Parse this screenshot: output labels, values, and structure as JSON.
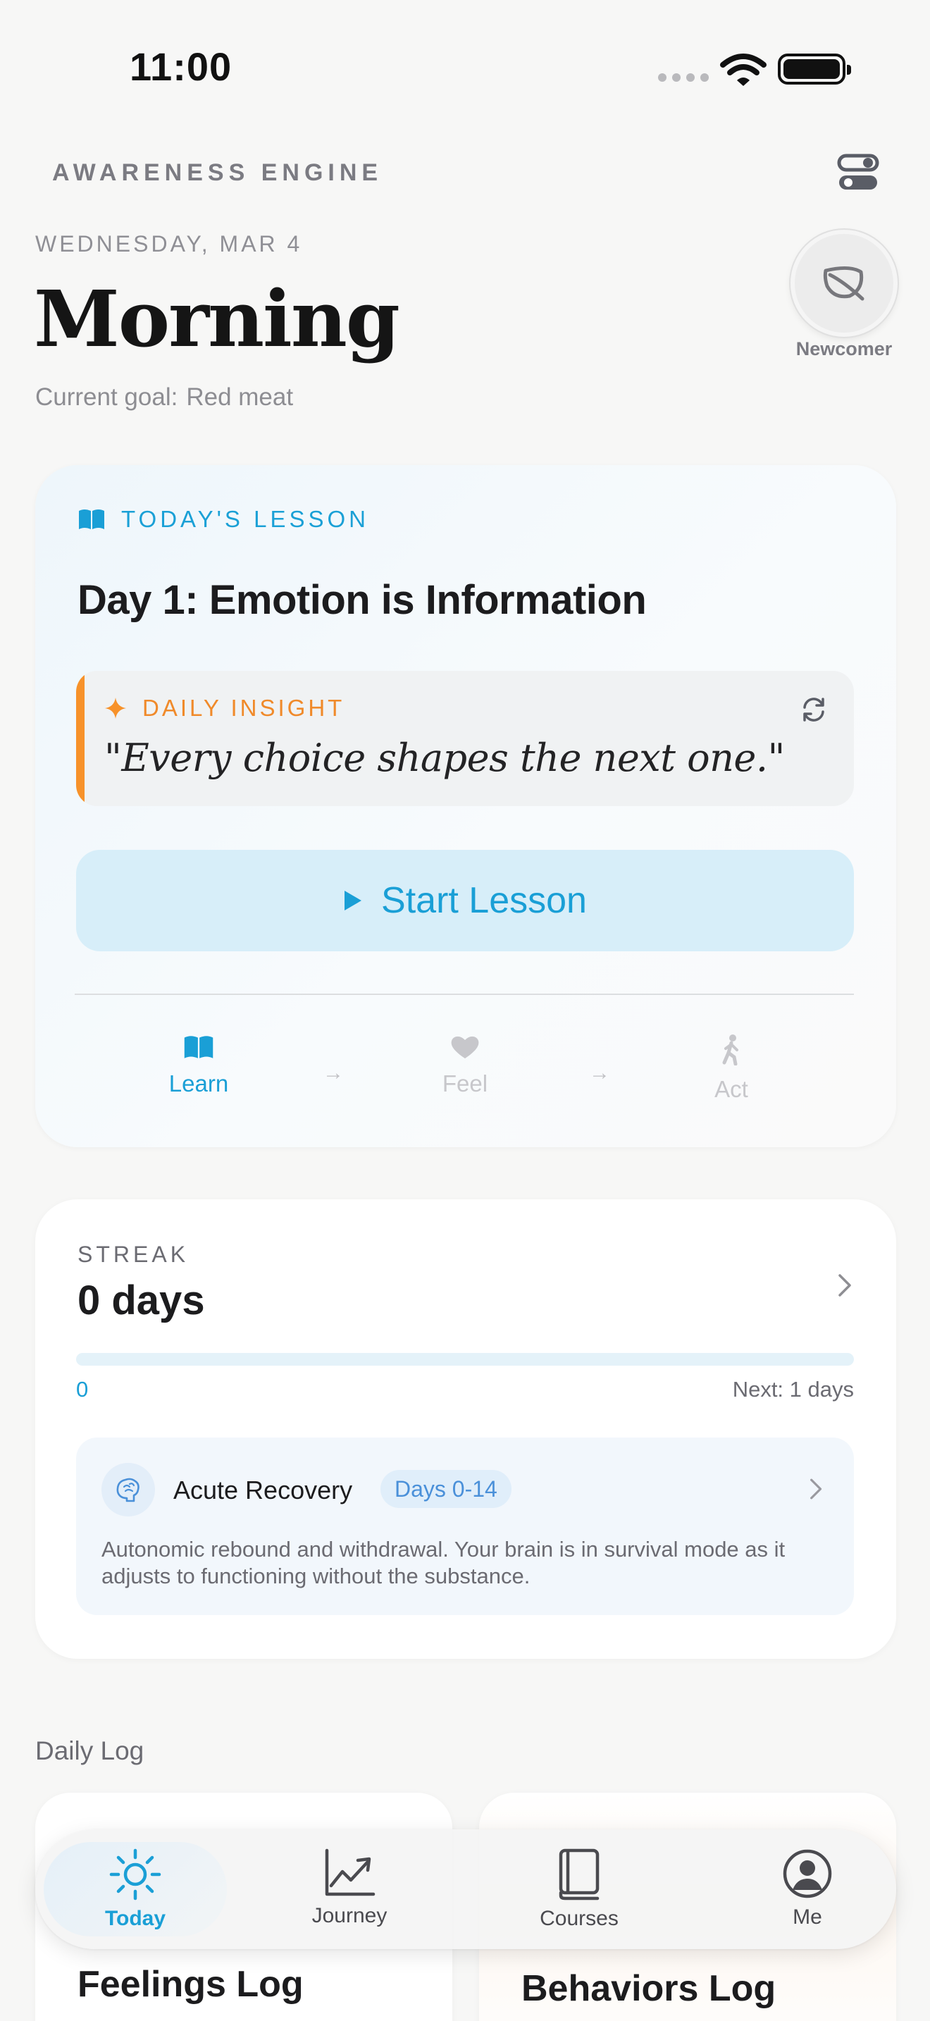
{
  "status_bar": {
    "time": "11:00"
  },
  "header": {
    "app_name": "AWARENESS ENGINE",
    "date": "WEDNESDAY, MAR 4",
    "greeting": "Morning",
    "goal_label": "Current goal:",
    "goal_value": "Red meat",
    "badge_label": "Newcomer"
  },
  "lesson": {
    "kicker": "TODAY'S LESSON",
    "title": "Day 1: Emotion is Information",
    "insight_kicker": "DAILY INSIGHT",
    "insight_quote": "\"Every choice shapes the next one.\"",
    "start_label": "Start Lesson",
    "steps": [
      {
        "label": "Learn",
        "icon": "book-icon",
        "active": true
      },
      {
        "label": "Feel",
        "icon": "heart-icon",
        "active": false
      },
      {
        "label": "Act",
        "icon": "walking-icon",
        "active": false
      }
    ]
  },
  "streak": {
    "kicker": "STREAK",
    "value": "0 days",
    "progress_fraction": 0,
    "start_label": "0",
    "next_label": "Next: 1 days",
    "phase": {
      "title": "Acute Recovery",
      "tag": "Days 0-14",
      "description": "Autonomic rebound and withdrawal. Your brain is in survival mode as it adjusts to functioning without the substance."
    }
  },
  "daily_log": {
    "heading": "Daily Log",
    "cards": [
      "Feelings Log",
      "Behaviors Log"
    ]
  },
  "tab_bar": {
    "tabs": [
      {
        "label": "Today",
        "icon": "sun-icon",
        "selected": true
      },
      {
        "label": "Journey",
        "icon": "chart-icon",
        "selected": false
      },
      {
        "label": "Courses",
        "icon": "book-icon",
        "selected": false
      },
      {
        "label": "Me",
        "icon": "person-icon",
        "selected": false
      }
    ]
  },
  "colors": {
    "accent": "#1a9fd6",
    "insight_accent": "#f7922a",
    "background": "#f7f7f6"
  }
}
